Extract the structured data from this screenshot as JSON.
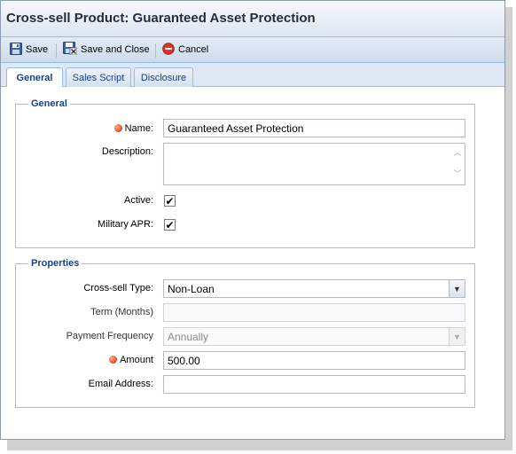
{
  "window": {
    "title": "Cross-sell Product: Guaranteed Asset Protection"
  },
  "toolbar": {
    "save_label": "Save",
    "save_close_label": "Save and Close",
    "cancel_label": "Cancel"
  },
  "tabs": [
    {
      "label": "General",
      "active": true
    },
    {
      "label": "Sales Script",
      "active": false
    },
    {
      "label": "Disclosure",
      "active": false
    }
  ],
  "general": {
    "legend": "General",
    "name_label": "Name:",
    "name_value": "Guaranteed Asset Protection",
    "description_label": "Description:",
    "description_value": "",
    "active_label": "Active:",
    "active_checked": true,
    "military_label": "Military APR:",
    "military_checked": true
  },
  "properties": {
    "legend": "Properties",
    "type_label": "Cross-sell Type:",
    "type_value": "Non-Loan",
    "term_label": "Term (Months)",
    "term_value": "",
    "freq_label": "Payment Frequency",
    "freq_value": "Annually",
    "amount_label": "Amount",
    "amount_value": "500.00",
    "email_label": "Email Address:",
    "email_value": ""
  },
  "colors": {
    "accent": "#15428b",
    "required_dot": "#e2461a",
    "cancel_icon": "#d9352a"
  },
  "icons": [
    "floppy-disk-icon",
    "save-close-icon",
    "cancel-icon",
    "required-icon",
    "checkmark-icon",
    "chevron-down-icon",
    "scroll-up-icon",
    "scroll-down-icon"
  ]
}
